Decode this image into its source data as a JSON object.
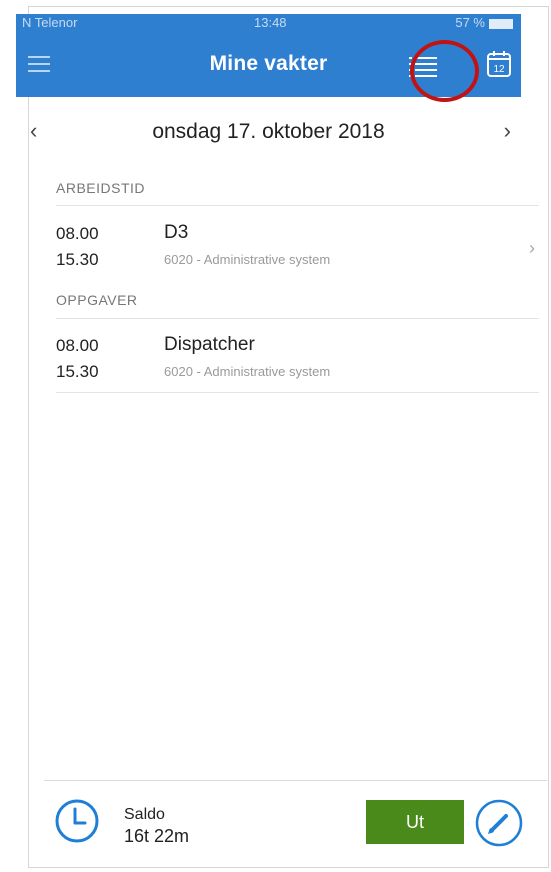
{
  "status_bar": {
    "carrier": "N Telenor",
    "time": "13:48",
    "battery": "57 %"
  },
  "header": {
    "title": "Mine vakter",
    "menu_icon": "hamburger-menu-icon",
    "list_icon": "list-view-icon",
    "calendar_icon": "calendar-icon",
    "calendar_day": "12",
    "accent_color": "#2f7fd0"
  },
  "date_nav": {
    "prev": "‹",
    "date": "onsdag 17. oktober 2018",
    "next": "›"
  },
  "sections": {
    "work_time": {
      "label": "ARBEIDSTID",
      "rows": [
        {
          "start": "08.00",
          "end": "15.30",
          "name": "D3",
          "desc": "6020 - Administrative system",
          "chevron": "›"
        }
      ]
    },
    "tasks": {
      "label": "OPPGAVER",
      "rows": [
        {
          "start": "08.00",
          "end": "15.30",
          "name": "Dispatcher",
          "desc": "6020 - Administrative system"
        }
      ]
    }
  },
  "footer": {
    "saldo_label": "Saldo",
    "saldo_value": "16t 22m",
    "clock_icon": "clock-icon",
    "ut_label": "Ut",
    "ut_color": "#4a8a1a",
    "edit_icon": "pencil-icon"
  }
}
